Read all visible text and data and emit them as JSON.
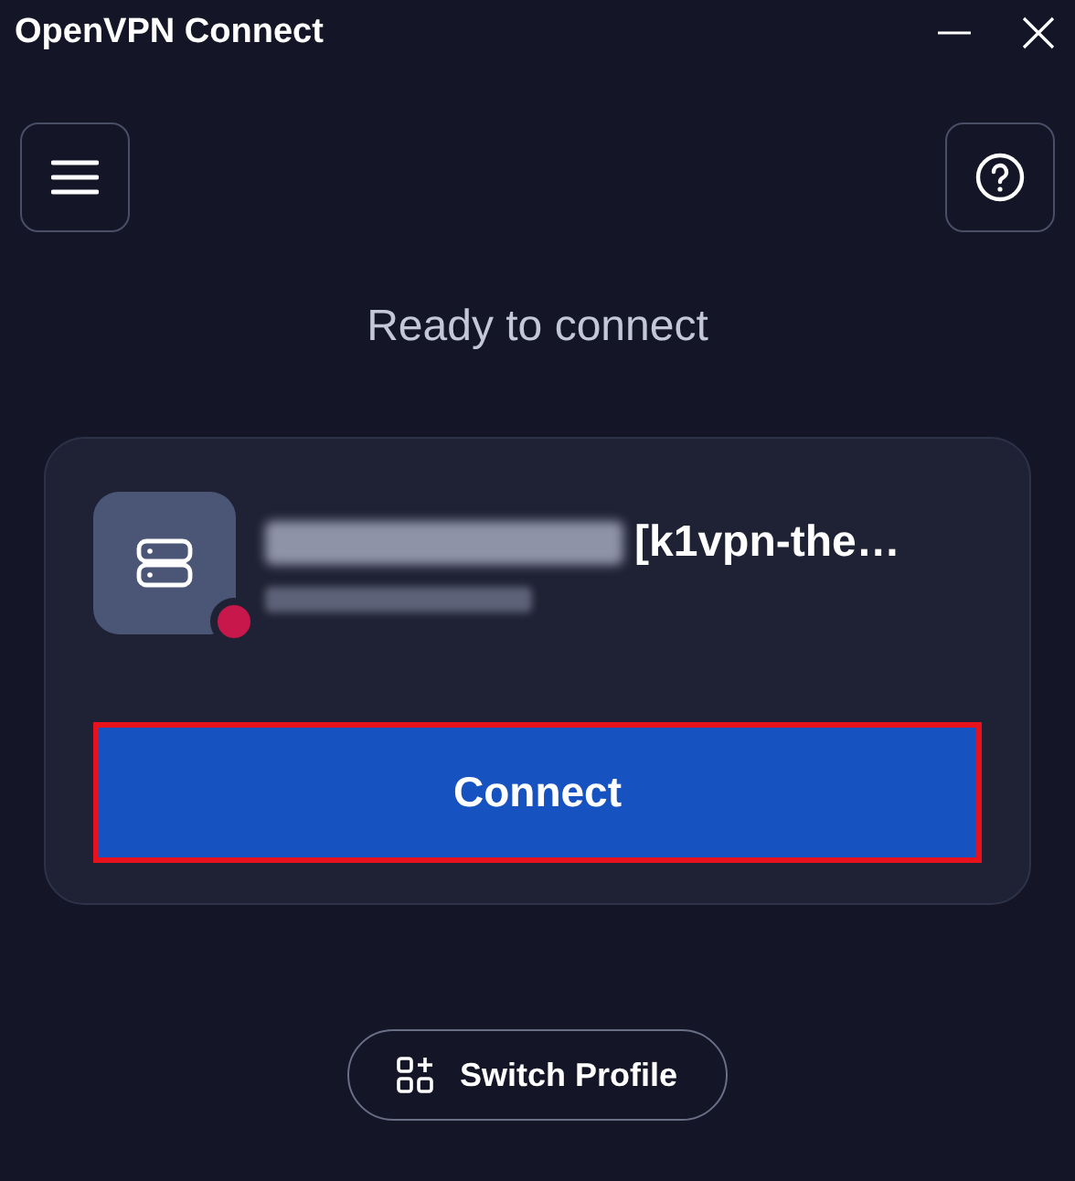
{
  "window": {
    "title": "OpenVPN Connect"
  },
  "status_text": "Ready to connect",
  "profile": {
    "name_suffix": "[k1vpn-the…",
    "connected": false,
    "name_redacted": true,
    "host_redacted": true
  },
  "connect_button": {
    "label": "Connect",
    "highlighted": true
  },
  "switch_button": {
    "label": "Switch Profile"
  }
}
